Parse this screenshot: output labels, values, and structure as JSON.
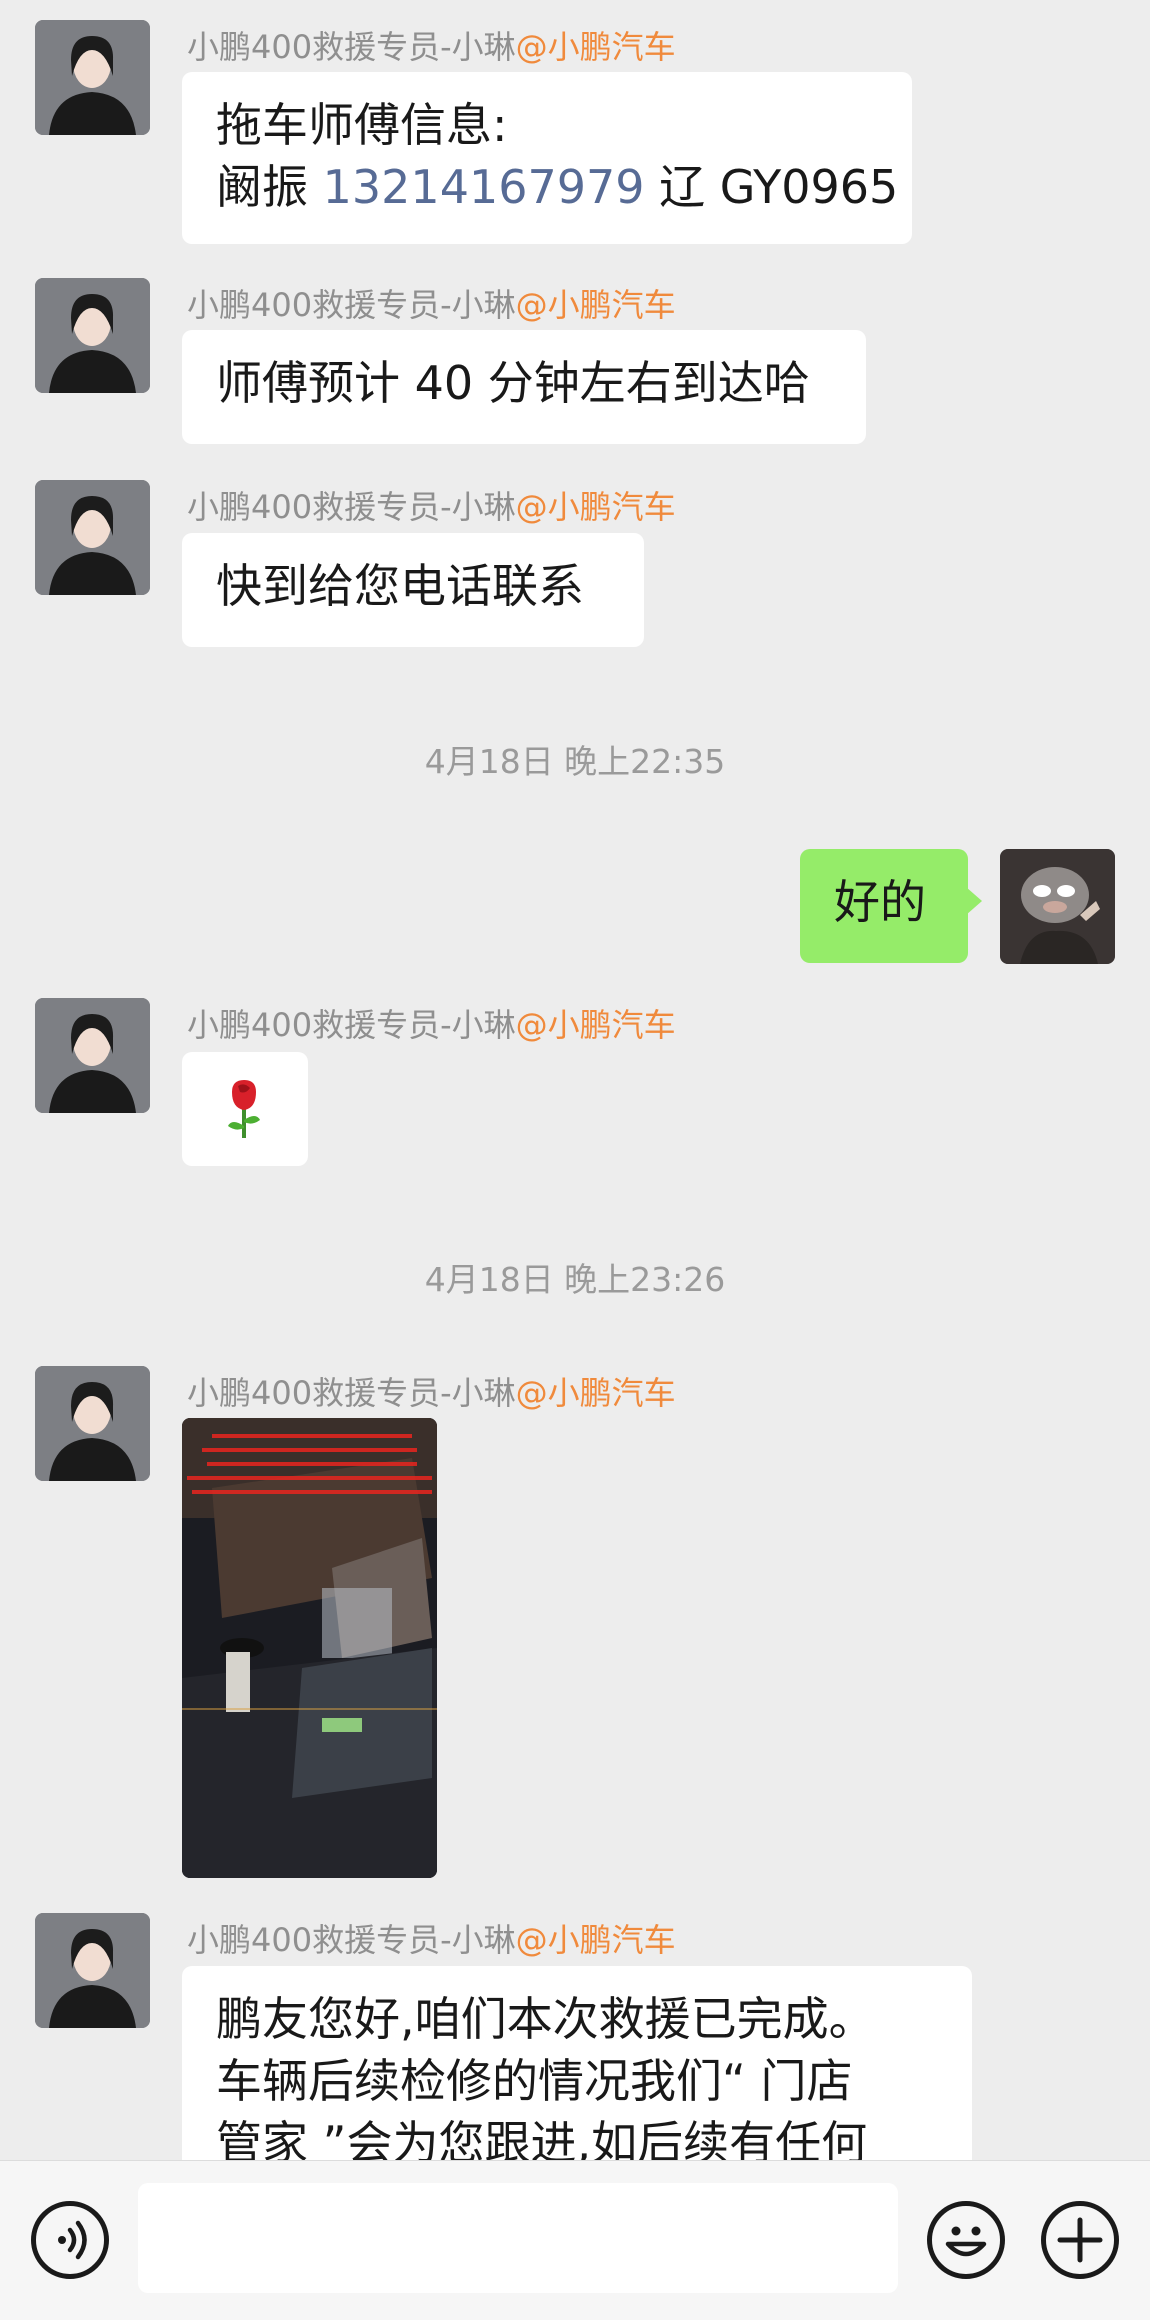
{
  "sender": {
    "name": "小鹏400救援专员-小琳",
    "org": "@小鹏汽车"
  },
  "messages": {
    "m1_line1": "拖车师傅信息:",
    "m1_name": "阚振 ",
    "m1_phone": "13214167979",
    "m1_plate": " 辽 GY0965",
    "m2": "师傅预计 40 分钟左右到达哈",
    "m3": "快到给您电话联系",
    "mine1": "好的",
    "m4_emoji": "🌹",
    "m6_line1": "鹏友您好,咱们本次救援已完成。",
    "m6_line2": "车辆后续检修的情况我们“ 门店",
    "m6_line3": "管家 ”会为您跟进,如后续有任何"
  },
  "timestamps": {
    "t1": "4月18日 晚上22:35",
    "t2": "4月18日 晚上23:26"
  },
  "bottom": {
    "voice_icon": "voice-icon",
    "emoji_icon": "emoji-icon",
    "plus_icon": "plus-icon"
  },
  "colors": {
    "background": "#ededed",
    "mine_bubble": "#95ec69",
    "phone_link": "#576b95",
    "org_name": "#f08a3c"
  }
}
